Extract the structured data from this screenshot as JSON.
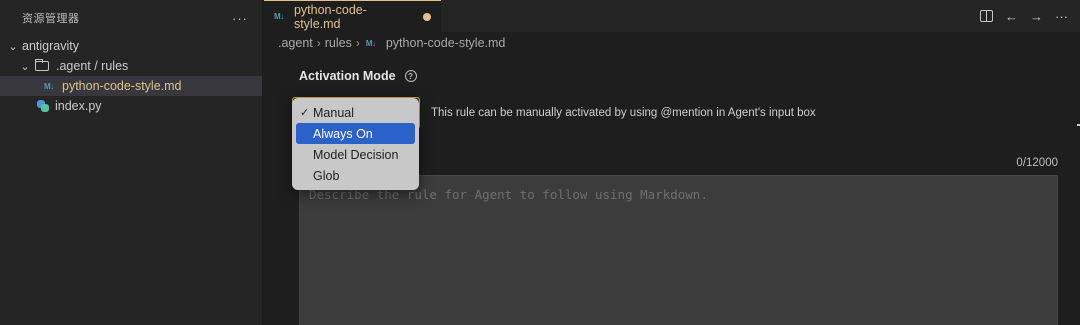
{
  "sidebar": {
    "title": "资源管理器",
    "more": "···",
    "tree": {
      "root": {
        "chevron": "⌄",
        "label": "antigravity"
      },
      "folder": {
        "chevron": "⌄",
        "label": ".agent / rules"
      },
      "file_md": {
        "badge": "M↓",
        "label": "python-code-style.md"
      },
      "file_py": {
        "label": "index.py"
      }
    }
  },
  "editor": {
    "tab": {
      "badge": "M↓",
      "label": "python-code-style.md"
    },
    "actions": {
      "back": "←",
      "forward": "→",
      "more": "···"
    },
    "breadcrumb": {
      "items": [
        ".agent",
        "rules"
      ],
      "sep": "›",
      "file_badge": "M↓",
      "file": "python-code-style.md"
    }
  },
  "rule": {
    "activation_label": "Activation Mode",
    "help": "?",
    "description": "This rule can be manually activated by using @mention in Agent's input box",
    "char_count": "0/12000",
    "placeholder": "Describe the rule for Agent to follow using Markdown.",
    "content": ""
  },
  "dropdown": {
    "check": "✓",
    "options": [
      "Manual",
      "Always On",
      "Model Decision",
      "Glob"
    ],
    "selected": "Manual",
    "highlighted": "Always On"
  },
  "colors": {
    "accent": "#e2c08d",
    "highlight": "#2a62c9",
    "select_border": "#d4a04a"
  },
  "icons": {
    "folder": "folder-icon",
    "markdown": "markdown-icon",
    "python": "python-icon",
    "split": "split-editor-icon",
    "help": "help-circle-icon"
  }
}
